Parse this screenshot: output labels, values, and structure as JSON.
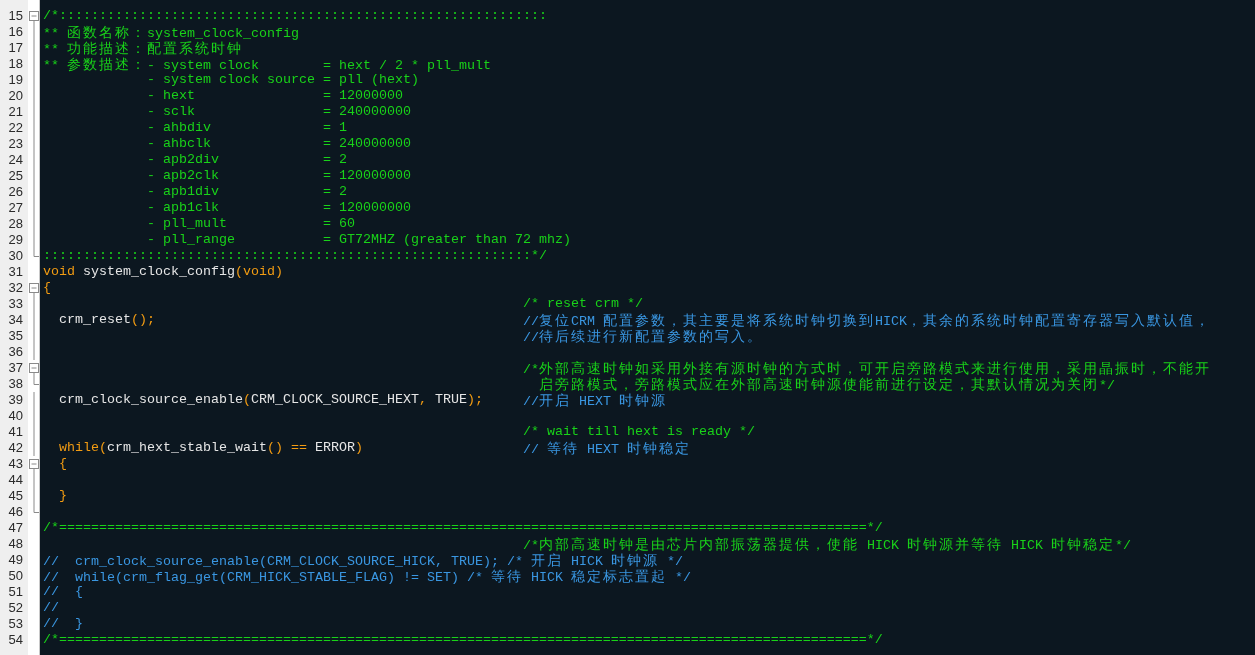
{
  "editor": {
    "lines": [
      {
        "number": "15",
        "kind": "fold_start",
        "expanded": true,
        "code": [
          {
            "kind": "comment",
            "text": "/*:::::::::::::::::::::::::::::::::::::::::::::::::::::::::::::"
          }
        ]
      },
      {
        "number": "16",
        "kind": "fold_body",
        "code": [
          {
            "kind": "comment",
            "text": "** 函数名称：system_clock_config"
          }
        ]
      },
      {
        "number": "17",
        "kind": "fold_body",
        "code": [
          {
            "kind": "comment",
            "text": "** 功能描述：配置系统时钟"
          }
        ]
      },
      {
        "number": "18",
        "kind": "fold_body",
        "code": [
          {
            "kind": "comment",
            "text": "** 参数描述：- system clock        = hext / 2 * pll_mult"
          }
        ]
      },
      {
        "number": "19",
        "kind": "fold_body",
        "code": [
          {
            "kind": "comment",
            "text": "             - system clock source = pll (hext)"
          }
        ]
      },
      {
        "number": "20",
        "kind": "fold_body",
        "code": [
          {
            "kind": "comment",
            "text": "             - hext                = 12000000"
          }
        ]
      },
      {
        "number": "21",
        "kind": "fold_body",
        "code": [
          {
            "kind": "comment",
            "text": "             - sclk                = 240000000"
          }
        ]
      },
      {
        "number": "22",
        "kind": "fold_body",
        "code": [
          {
            "kind": "comment",
            "text": "             - ahbdiv              = 1"
          }
        ]
      },
      {
        "number": "23",
        "kind": "fold_body",
        "code": [
          {
            "kind": "comment",
            "text": "             - ahbclk              = 240000000"
          }
        ]
      },
      {
        "number": "24",
        "kind": "fold_body",
        "code": [
          {
            "kind": "comment",
            "text": "             - apb2div             = 2"
          }
        ]
      },
      {
        "number": "25",
        "kind": "fold_body",
        "code": [
          {
            "kind": "comment",
            "text": "             - apb2clk             = 120000000"
          }
        ]
      },
      {
        "number": "26",
        "kind": "fold_body",
        "code": [
          {
            "kind": "comment",
            "text": "             - apb1div             = 2"
          }
        ]
      },
      {
        "number": "27",
        "kind": "fold_body",
        "code": [
          {
            "kind": "comment",
            "text": "             - apb1clk             = 120000000"
          }
        ]
      },
      {
        "number": "28",
        "kind": "fold_body",
        "code": [
          {
            "kind": "comment",
            "text": "             - pll_mult            = 60"
          }
        ]
      },
      {
        "number": "29",
        "kind": "fold_body",
        "code": [
          {
            "kind": "comment",
            "text": "             - pll_range           = GT72MHZ (greater than 72 mhz)"
          }
        ]
      },
      {
        "number": "30",
        "kind": "fold_end",
        "code": [
          {
            "kind": "comment",
            "text": ":::::::::::::::::::::::::::::::::::::::::::::::::::::::::::::*/"
          }
        ]
      },
      {
        "number": "31",
        "kind": "plain",
        "code": [
          {
            "kind": "keyword",
            "text": "void"
          },
          {
            "kind": "code",
            "text": " system_clock_config("
          },
          {
            "kind": "keyword",
            "text": "void"
          },
          {
            "kind": "code",
            "text": ")"
          }
        ]
      },
      {
        "number": "32",
        "kind": "fold_start",
        "expanded": true,
        "code": [
          {
            "kind": "code",
            "text": "{"
          }
        ]
      },
      {
        "number": "33",
        "kind": "fold_body",
        "note": {
          "kind": "comment",
          "text": "/* reset crm */"
        }
      },
      {
        "number": "34",
        "kind": "fold_body",
        "code": [
          {
            "kind": "code",
            "text": "  crm_reset();"
          }
        ],
        "note": {
          "kind": "line_comment",
          "text": "//复位CRM 配置参数，其主要是将系统时钟切换到HICK，其余的系统时钟配置寄存器写入默认值，"
        }
      },
      {
        "number": "35",
        "kind": "fold_body",
        "note": {
          "kind": "line_comment",
          "text": "//待后续进行新配置参数的写入。"
        }
      },
      {
        "number": "36",
        "kind": "fold_body"
      },
      {
        "number": "37",
        "kind": "fold_start",
        "expanded": true,
        "note": {
          "kind": "comment",
          "text": "/*外部高速时钟如采用外接有源时钟的方式时，可开启旁路模式来进行使用，采用晶振时，不能开"
        }
      },
      {
        "number": "38",
        "kind": "fold_end",
        "note": {
          "kind": "comment",
          "text": "  启旁路模式，旁路模式应在外部高速时钟源使能前进行设定，其默认情况为关闭*/"
        }
      },
      {
        "number": "39",
        "kind": "fold_body",
        "code": [
          {
            "kind": "code",
            "text": "  crm_clock_source_enable(CRM_CLOCK_SOURCE_HEXT, TRUE);"
          }
        ],
        "note": {
          "kind": "line_comment",
          "text": "//开启 HEXT 时钟源"
        }
      },
      {
        "number": "40",
        "kind": "fold_body"
      },
      {
        "number": "41",
        "kind": "fold_body",
        "note": {
          "kind": "comment",
          "text": "/* wait till hext is ready */"
        }
      },
      {
        "number": "42",
        "kind": "fold_body",
        "code": [
          {
            "kind": "keyword",
            "text": "  while"
          },
          {
            "kind": "code",
            "text": "(crm_hext_stable_wait() == ERROR)"
          }
        ],
        "note": {
          "kind": "line_comment",
          "text": "// 等待 HEXT 时钟稳定"
        }
      },
      {
        "number": "43",
        "kind": "fold_start",
        "expanded": true,
        "code": [
          {
            "kind": "code",
            "text": "  {"
          }
        ]
      },
      {
        "number": "44",
        "kind": "fold_body"
      },
      {
        "number": "45",
        "kind": "fold_body",
        "code": [
          {
            "kind": "code",
            "text": "  }"
          }
        ]
      },
      {
        "number": "46",
        "kind": "fold_end"
      },
      {
        "number": "47",
        "kind": "plain",
        "code": [
          {
            "kind": "comment",
            "text": "/*=====================================================================================================*/"
          }
        ]
      },
      {
        "number": "48",
        "kind": "plain",
        "note": {
          "kind": "comment",
          "text": "/*内部高速时钟是由芯片内部振荡器提供，使能 HICK 时钟源并等待 HICK 时钟稳定*/"
        }
      },
      {
        "number": "49",
        "kind": "plain",
        "code": [
          {
            "kind": "line_comment",
            "text": "//  crm_clock_source_enable(CRM_CLOCK_SOURCE_HICK, TRUE); /* 开启 HICK 时钟源 */"
          }
        ]
      },
      {
        "number": "50",
        "kind": "plain",
        "code": [
          {
            "kind": "line_comment",
            "text": "//  while(crm_flag_get(CRM_HICK_STABLE_FLAG) != SET) /* 等待 HICK 稳定标志置起 */"
          }
        ]
      },
      {
        "number": "51",
        "kind": "plain",
        "code": [
          {
            "kind": "line_comment",
            "text": "//  {"
          }
        ]
      },
      {
        "number": "52",
        "kind": "plain",
        "code": [
          {
            "kind": "line_comment",
            "text": "//"
          }
        ]
      },
      {
        "number": "53",
        "kind": "plain",
        "code": [
          {
            "kind": "line_comment",
            "text": "//  }"
          }
        ]
      },
      {
        "number": "54",
        "kind": "plain",
        "code": [
          {
            "kind": "comment",
            "text": "/*=====================================================================================================*/"
          }
        ]
      }
    ]
  }
}
